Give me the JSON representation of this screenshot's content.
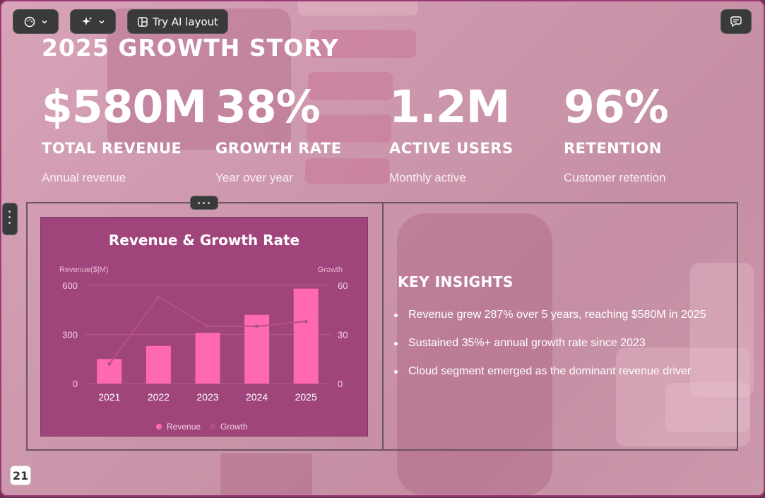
{
  "toolbar": {
    "theme_icon": "palette-icon",
    "ai_icon": "sparkle-icon",
    "layout_icon": "layout-icon",
    "try_ai_label": "Try AI layout",
    "comment_icon": "comment-icon"
  },
  "slide": {
    "title": "2025 GROWTH STORY",
    "stats": [
      {
        "value": "$580M",
        "label": "TOTAL REVENUE",
        "sub": "Annual revenue"
      },
      {
        "value": "38%",
        "label": "GROWTH RATE",
        "sub": "Year over year"
      },
      {
        "value": "1.2M",
        "label": "ACTIVE USERS",
        "sub": "Monthly active"
      },
      {
        "value": "96%",
        "label": "RETENTION",
        "sub": "Customer retention"
      }
    ],
    "insights_title": "KEY INSIGHTS",
    "insights": [
      "Revenue grew 287% over 5 years, reaching $580M in 2025",
      "Sustained 35%+ annual growth rate since 2023",
      "Cloud segment emerged as the dominant revenue driver"
    ],
    "page_number": "21"
  },
  "colors": {
    "bar": "#ff69b4",
    "line": "#b2508a",
    "card_bg": "#a0457c",
    "accent_border": "#9a3a74"
  },
  "chart_data": {
    "type": "bar",
    "title": "Revenue & Growth Rate",
    "categories": [
      "2021",
      "2022",
      "2023",
      "2024",
      "2025"
    ],
    "series": [
      {
        "name": "Revenue",
        "type": "bar",
        "axis": "left",
        "values": [
          150,
          230,
          310,
          420,
          580
        ]
      },
      {
        "name": "Growth",
        "type": "line",
        "axis": "right",
        "values": [
          12,
          53,
          35,
          35,
          38
        ]
      }
    ],
    "ylabel_left": "Revenue($|M)",
    "ylabel_right": "Growth",
    "ylim_left": [
      0,
      600
    ],
    "ylim_right": [
      0,
      60
    ],
    "yticks_left": [
      "0",
      "300",
      "600"
    ],
    "yticks_right": [
      "0",
      "30",
      "60"
    ],
    "legend_position": "bottom",
    "grid": true
  }
}
